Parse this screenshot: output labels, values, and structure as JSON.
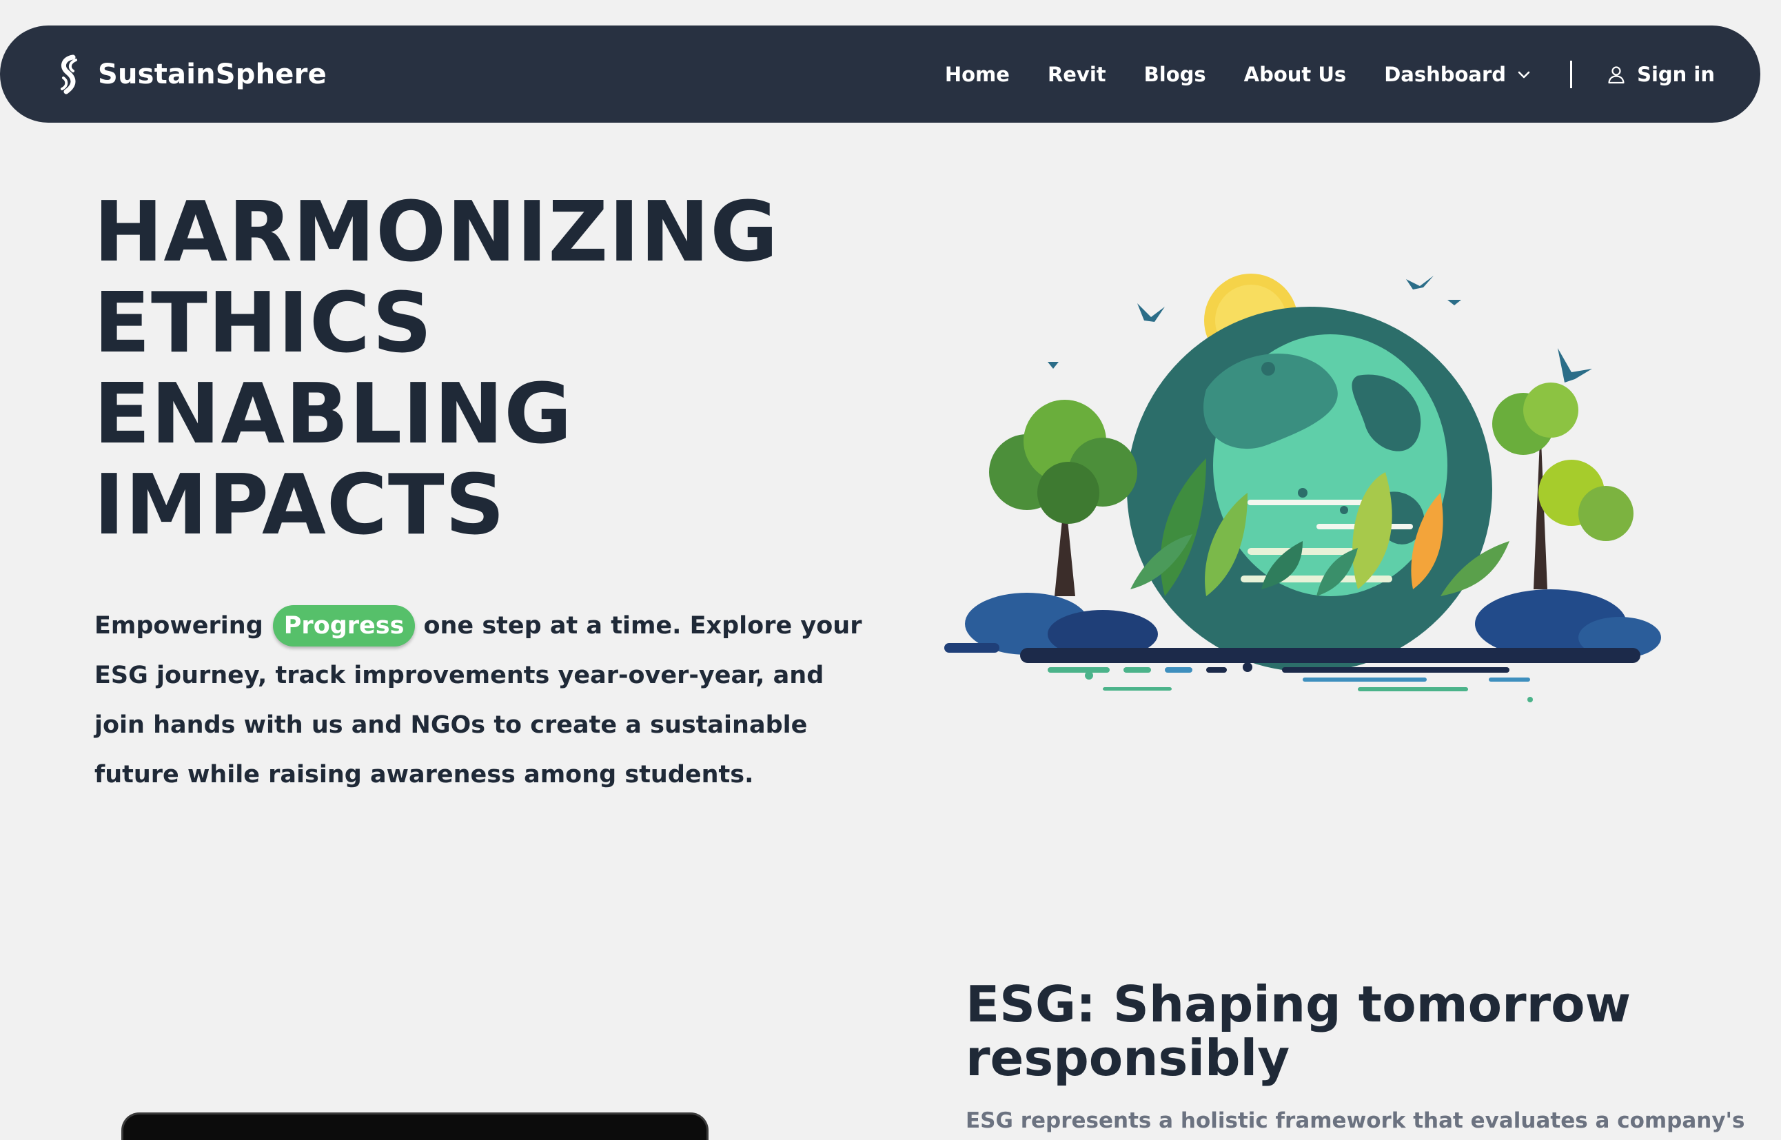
{
  "brand": {
    "name": "SustainSphere"
  },
  "nav": {
    "home": "Home",
    "revit": "Revit",
    "blogs": "Blogs",
    "about": "About Us",
    "dashboard": "Dashboard",
    "signin": "Sign in"
  },
  "hero": {
    "title_lines": [
      "HARMONIZING",
      "ETHICS",
      "ENABLING",
      "IMPACTS"
    ],
    "text_before": "Empowering",
    "highlight": "Progress",
    "text_after": "one step at a time. Explore your ESG journey, track improvements year-over-year, and join hands with us and NGOs to create a sustainable future while raising awareness among students."
  },
  "esg": {
    "title": "ESG: Shaping tomorrow responsibly",
    "text": "ESG represents a holistic framework that evaluates a company's"
  },
  "icons": {
    "brand": "sustainsphere-logo-icon",
    "dropdown": "chevron-down-icon",
    "user": "user-icon",
    "illustration": "earth-nature-illustration"
  },
  "colors": {
    "navbar_bg": "#283141",
    "page_bg": "#f1f1f1",
    "accent_green": "#56c06a",
    "text_dark": "#1f2937",
    "text_muted": "#6b7280"
  }
}
